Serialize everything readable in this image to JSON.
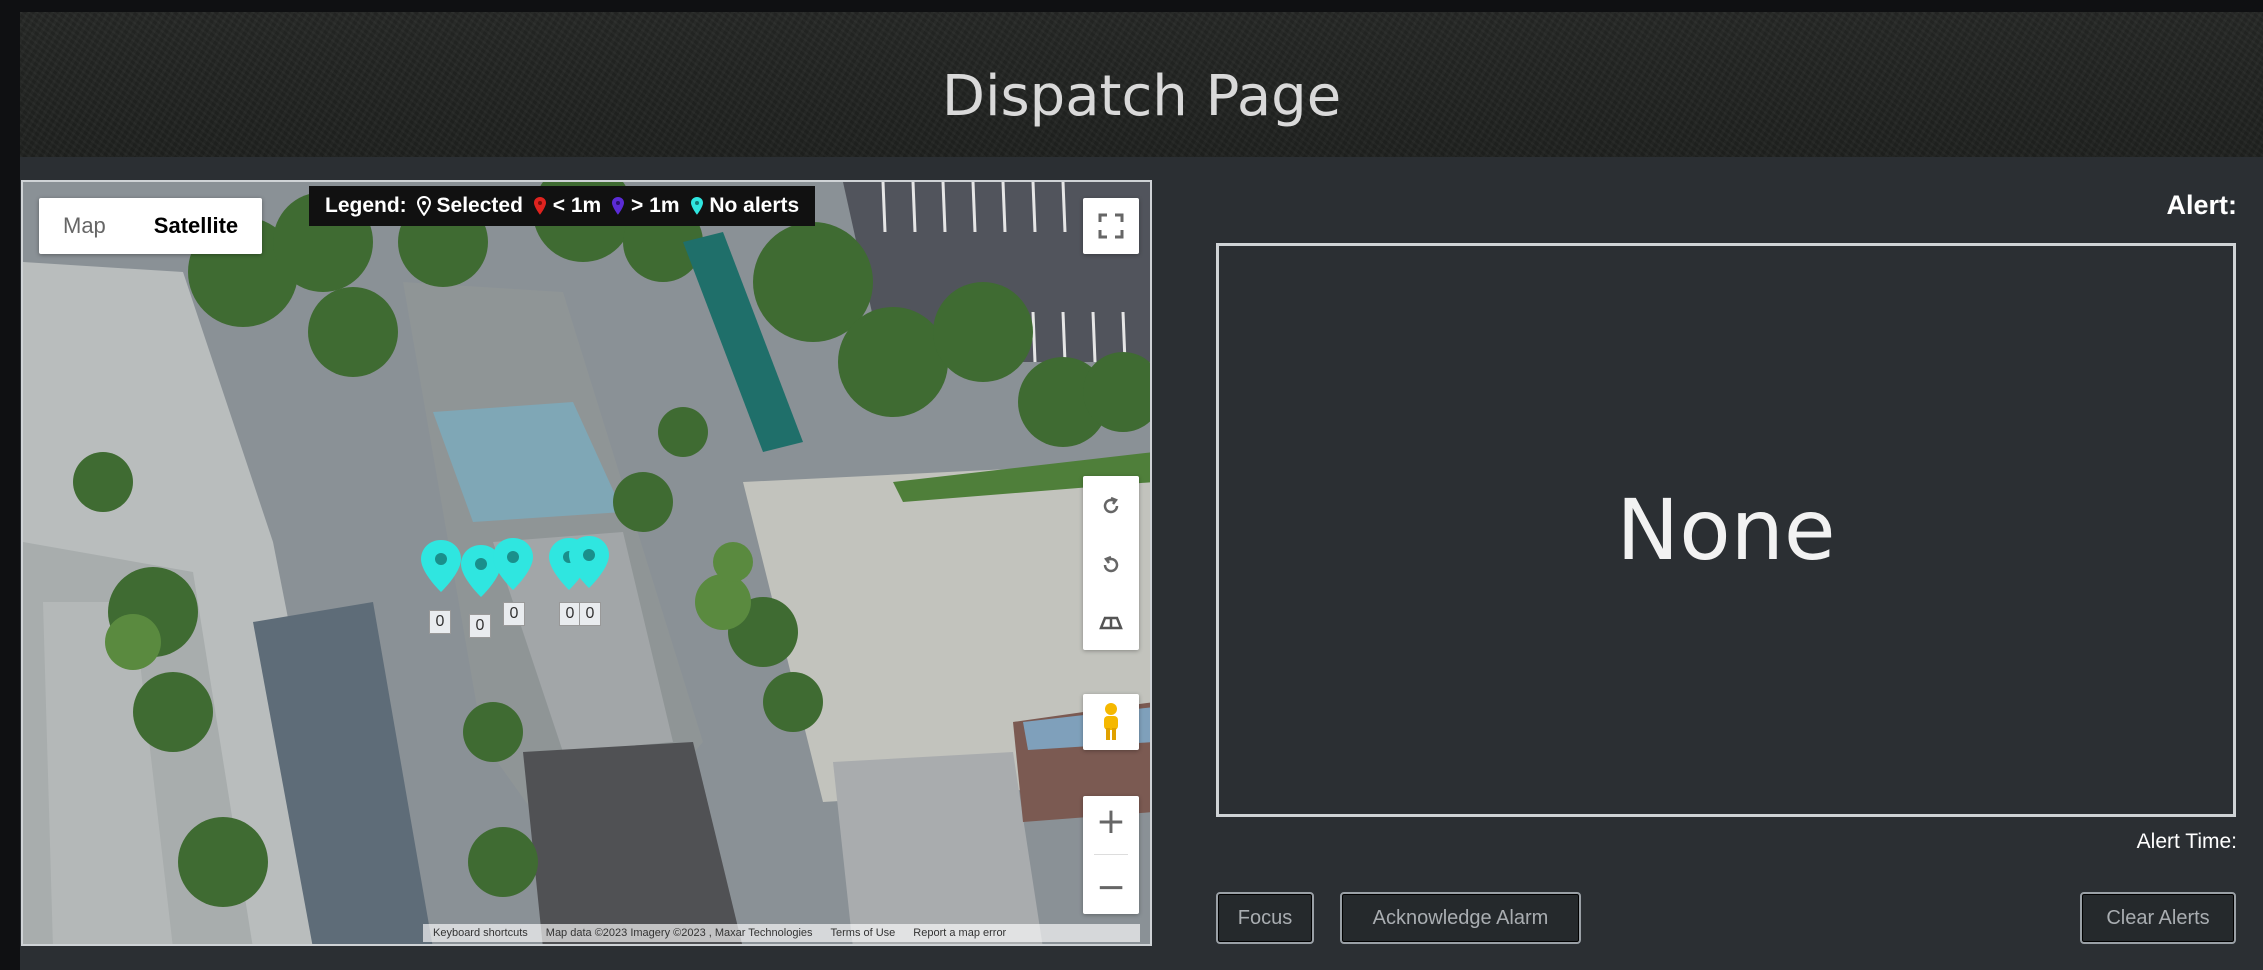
{
  "header": {
    "title": "Dispatch Page"
  },
  "map": {
    "map_type": {
      "map_label": "Map",
      "satellite_label": "Satellite",
      "selected": "Satellite"
    },
    "legend": {
      "title": "Legend:",
      "items": [
        {
          "label": "Selected",
          "color": "#ffffff"
        },
        {
          "label": "< 1m",
          "color": "#e0231f"
        },
        {
          "label": "> 1m",
          "color": "#5b2bd6"
        },
        {
          "label": "No alerts",
          "color": "#2fe6e0"
        }
      ]
    },
    "markers": [
      {
        "label": "0",
        "color": "#2fe6e0"
      },
      {
        "label": "0",
        "color": "#2fe6e0"
      },
      {
        "label": "0",
        "color": "#2fe6e0"
      },
      {
        "label": "0",
        "color": "#2fe6e0"
      },
      {
        "label": "0",
        "color": "#2fe6e0"
      }
    ],
    "controls": {
      "fullscreen_icon": "fullscreen-icon",
      "rotate_left_icon": "rotate-left-icon",
      "rotate_right_icon": "rotate-right-icon",
      "tilt_icon": "tilt-icon",
      "pegman_icon": "pegman-icon",
      "zoom_in": "+",
      "zoom_out": "−"
    },
    "attribution": {
      "shortcuts": "Keyboard shortcuts",
      "map_data": "Map data ©2023 Imagery ©2023 , Maxar Technologies",
      "terms": "Terms of Use",
      "report": "Report a map error"
    }
  },
  "alert_panel": {
    "label": "Alert:",
    "current_alert": "None",
    "time_label": "Alert Time:"
  },
  "buttons": {
    "focus": "Focus",
    "acknowledge": "Acknowledge Alarm",
    "clear": "Clear Alerts"
  },
  "colors": {
    "panel_bg": "#2b2f33",
    "header_bg": "#232523",
    "border": "#cfd3d6",
    "no_alert_pin": "#2fe6e0"
  }
}
